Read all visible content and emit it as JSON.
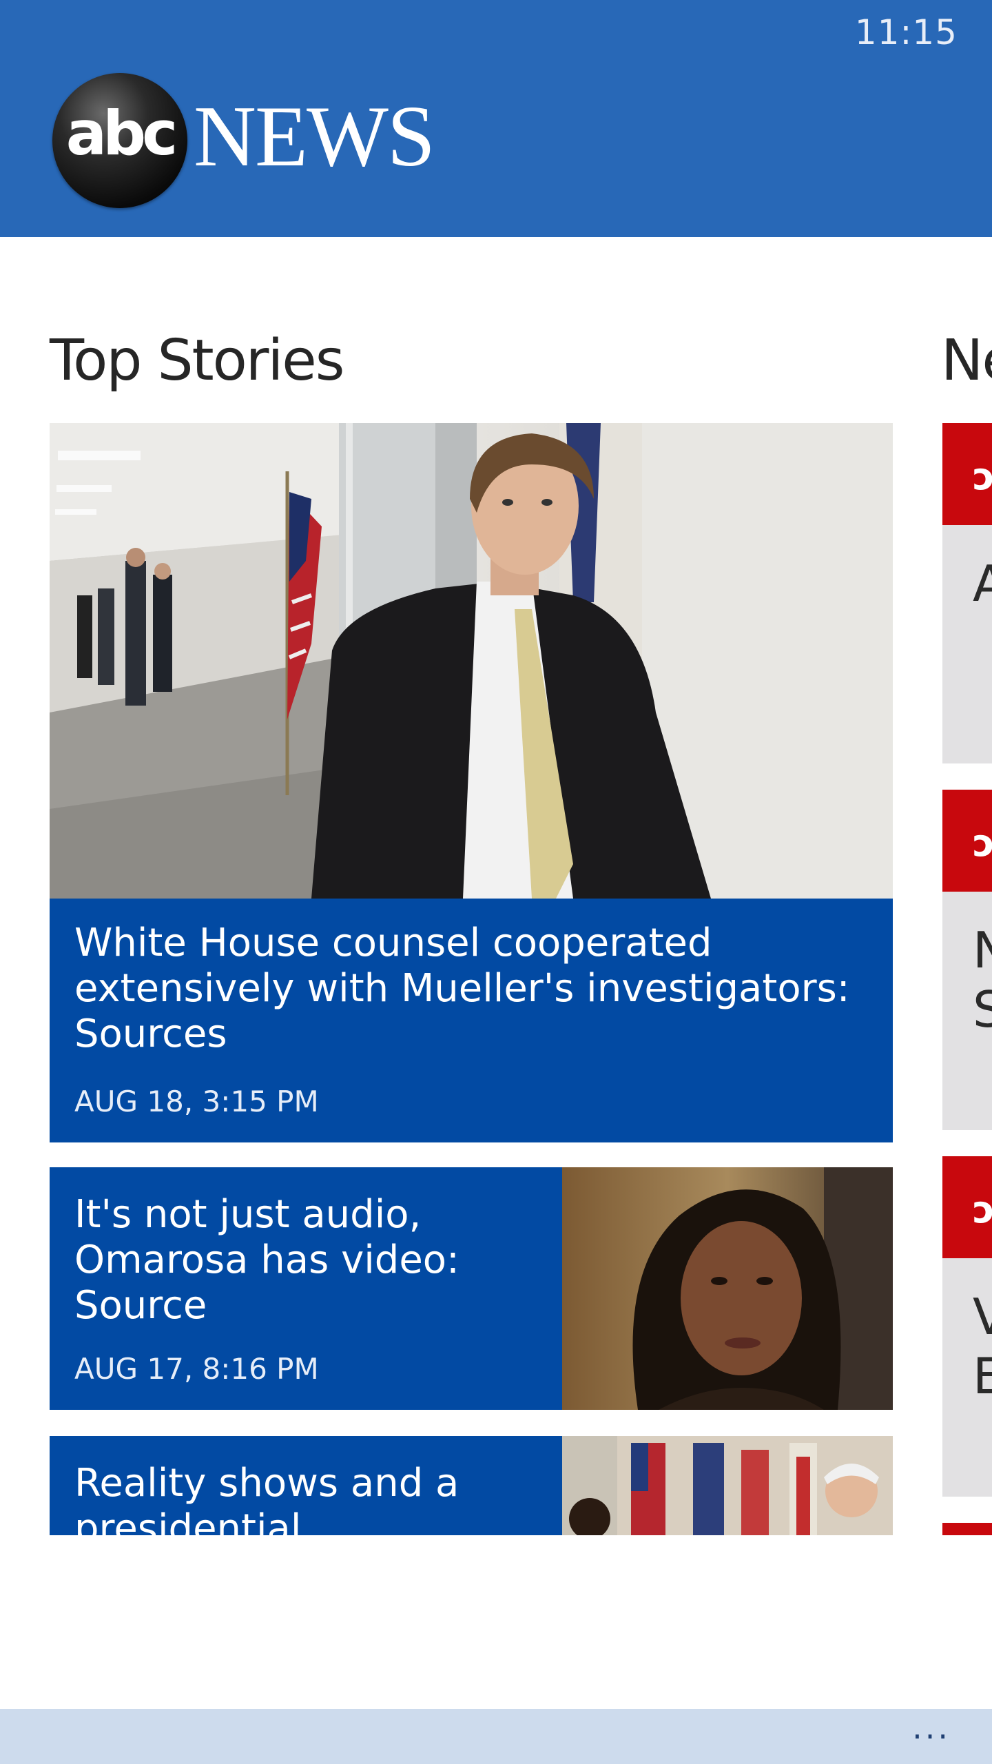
{
  "status": {
    "time": "11:15"
  },
  "header": {
    "logo_abc": "abc",
    "logo_news": "NEWS",
    "brand_color": "#2868b7"
  },
  "sections": {
    "top_stories_title": "Top Stories",
    "next_title_partial": "Ne"
  },
  "stories": [
    {
      "headline": "White House counsel cooperated extensively with Mueller's investigators: Sources",
      "time": "AUG 18, 3:15 PM",
      "image": "man-in-suit-hallway-photo"
    },
    {
      "headline": "It's not just audio, Omarosa has video: Source",
      "time": "AUG 17, 8:16 PM",
      "image": "omarosa-portrait-photo"
    },
    {
      "headline": "Reality shows and a presidential",
      "time": "",
      "image": "white-house-flags-photo"
    }
  ],
  "right_column": {
    "cards": [
      {
        "icon": "abc-icon",
        "text": "A"
      },
      {
        "icon": "abc-icon",
        "text": "N\nS"
      },
      {
        "icon": "abc-icon",
        "text": "V\nE"
      }
    ]
  },
  "appbar": {
    "more_label": "..."
  },
  "colors": {
    "tile_blue": "#024aa3",
    "accent_red": "#c8080d",
    "appbar": "#cddbed"
  }
}
